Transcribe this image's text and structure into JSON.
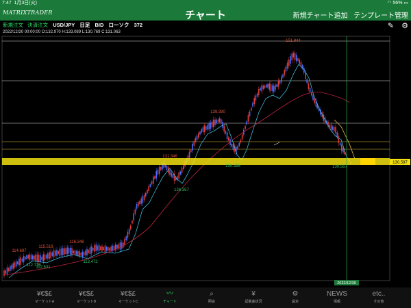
{
  "status": {
    "time": "7:47",
    "date": "1月3日(火)",
    "battery": "56%"
  },
  "app": {
    "logo": "MATRIXTRADER",
    "title": "チャート",
    "link1": "新規チャート追加",
    "link2": "テンプレート管理"
  },
  "toolbar": {
    "new_order": "新規注文",
    "settle_order": "決済注文",
    "pair": "USD/JPY",
    "timeframe": "日足",
    "side": "BID",
    "chart_type": "ローソク",
    "bars": "372"
  },
  "ohlc": "2022/12/30 00:00:00   O:132.970  H:133.089  L:130.769  C:131.063",
  "chart_data": {
    "type": "candlestick",
    "price_labels": [
      {
        "text": "151.944",
        "color": "#e0533a"
      },
      {
        "text": "139.390",
        "color": "#e0533a"
      },
      {
        "text": "131.346",
        "color": "#e0533a"
      },
      {
        "text": "130.395",
        "color": "#31c060"
      },
      {
        "text": "126.357",
        "color": "#31c060"
      },
      {
        "text": "130.567",
        "color": "#31c060"
      },
      {
        "text": "116.348",
        "color": "#e0533a"
      },
      {
        "text": "115.519",
        "color": "#e0533a"
      },
      {
        "text": "114.697",
        "color": "#e0533a"
      },
      {
        "text": "113.472",
        "color": "#31c060"
      },
      {
        "text": "112.726",
        "color": "#31c060"
      },
      {
        "text": "112.531",
        "color": "#31c060"
      }
    ],
    "current_price": "130.597",
    "crosshair_date": "2022/12/30"
  },
  "tabs": [
    {
      "icon": "¥€$£",
      "label": "マーケットA"
    },
    {
      "icon": "¥€$£",
      "label": "マーケットB"
    },
    {
      "icon": "¥€$£",
      "label": "マーケットC"
    },
    {
      "icon": "〰",
      "label": "チャート"
    },
    {
      "icon": "⌕",
      "label": "照会"
    },
    {
      "icon": "¥",
      "label": "証拠金状況"
    },
    {
      "icon": "⚙",
      "label": "設定"
    },
    {
      "icon": "NEWS",
      "label": "情報"
    },
    {
      "icon": "etc..",
      "label": "その他"
    }
  ]
}
